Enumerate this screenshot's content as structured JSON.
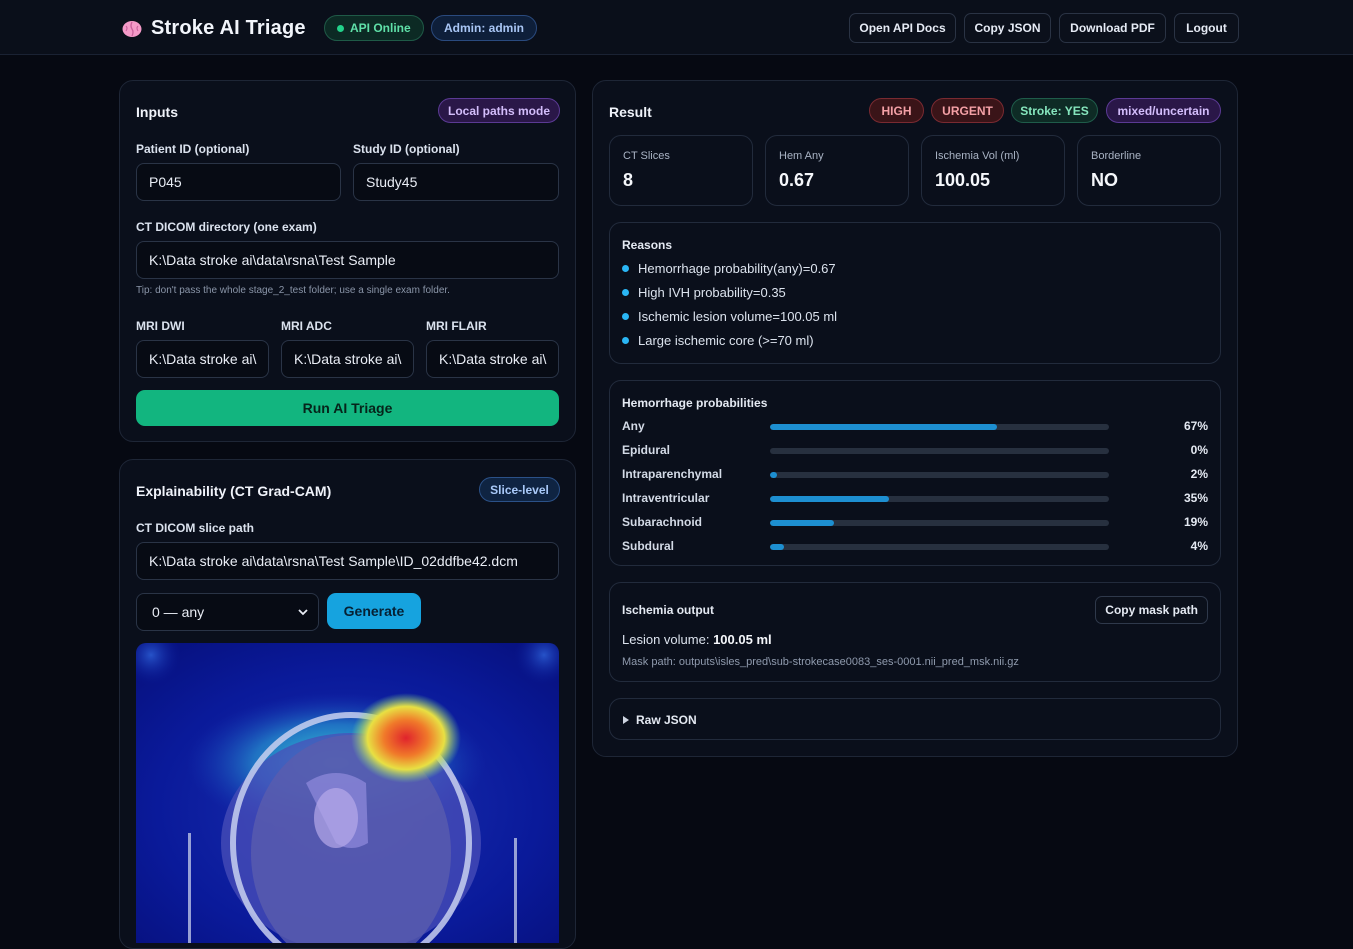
{
  "header": {
    "app_title": "Stroke AI Triage",
    "api_status": "API Online",
    "admin_label": "Admin: admin",
    "buttons": {
      "open_api_docs": "Open API Docs",
      "copy_json": "Copy JSON",
      "download_pdf": "Download PDF",
      "logout": "Logout"
    }
  },
  "inputs": {
    "title": "Inputs",
    "mode_badge": "Local paths mode",
    "patient_id_label": "Patient ID (optional)",
    "patient_id_value": "P045",
    "study_id_label": "Study ID (optional)",
    "study_id_value": "Study45",
    "ct_dir_label": "CT DICOM directory (one exam)",
    "ct_dir_value": "K:\\Data stroke ai\\data\\rsna\\Test Sample",
    "tip": "Tip: don't pass the whole stage_2_test folder; use a single exam folder.",
    "mri_dwi_label": "MRI DWI",
    "mri_dwi_value": "K:\\Data stroke ai\\",
    "mri_adc_label": "MRI ADC",
    "mri_adc_value": "K:\\Data stroke ai\\",
    "mri_flair_label": "MRI FLAIR",
    "mri_flair_value": "K:\\Data stroke ai\\",
    "run_button": "Run AI Triage"
  },
  "explain": {
    "title": "Explainability (CT Grad-CAM)",
    "badge": "Slice-level",
    "slice_label": "CT DICOM slice path",
    "slice_value": "K:\\Data stroke ai\\data\\rsna\\Test Sample\\ID_02ddfbe42.dcm",
    "target_select": "0 — any",
    "generate_button": "Generate"
  },
  "result": {
    "title": "Result",
    "badges": {
      "priority": "HIGH",
      "urgency": "URGENT",
      "stroke": "Stroke: YES",
      "type": "mixed/uncertain"
    },
    "stats": [
      {
        "label": "CT Slices",
        "value": "8"
      },
      {
        "label": "Hem Any",
        "value": "0.67"
      },
      {
        "label": "Ischemia Vol (ml)",
        "value": "100.05"
      },
      {
        "label": "Borderline",
        "value": "NO"
      }
    ],
    "reasons_title": "Reasons",
    "reasons": [
      "Hemorrhage probability(any)=0.67",
      "High IVH probability=0.35",
      "Ischemic lesion volume=100.05 ml",
      "Large ischemic core (>=70 ml)"
    ],
    "hemorrhage_title": "Hemorrhage probabilities",
    "hemorrhage": [
      {
        "label": "Any",
        "value": 0.67,
        "pct": "67%"
      },
      {
        "label": "Epidural",
        "value": 0.0,
        "pct": "0%"
      },
      {
        "label": "Intraparenchymal",
        "value": 0.02,
        "pct": "2%"
      },
      {
        "label": "Intraventricular",
        "value": 0.35,
        "pct": "35%"
      },
      {
        "label": "Subarachnoid",
        "value": 0.19,
        "pct": "19%"
      },
      {
        "label": "Subdural",
        "value": 0.04,
        "pct": "4%"
      }
    ],
    "ischemia_title": "Ischemia output",
    "copy_mask_button": "Copy mask path",
    "lesion_label": "Lesion volume:",
    "lesion_value": "100.05 ml",
    "mask_path": "Mask path: outputs\\isles_pred\\sub-strokecase0083_ses-0001.nii_pred_msk.nii.gz",
    "raw_json": "Raw JSON"
  },
  "colors": {
    "accent_green": "#12b57f",
    "accent_blue": "#16a3df",
    "bar_fill": "#1d8fd1"
  }
}
